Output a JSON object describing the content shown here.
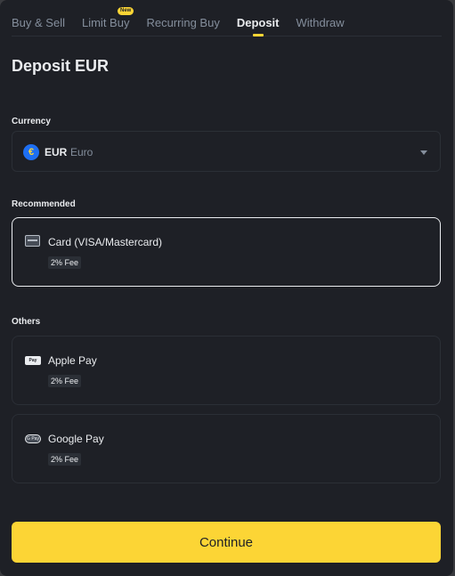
{
  "tabs": [
    {
      "label": "Buy & Sell"
    },
    {
      "label": "Limit Buy",
      "badge": "New"
    },
    {
      "label": "Recurring Buy"
    },
    {
      "label": "Deposit"
    },
    {
      "label": "Withdraw"
    }
  ],
  "active_tab": "Deposit",
  "title": "Deposit EUR",
  "currency": {
    "label": "Currency",
    "symbol": "€",
    "code": "EUR",
    "name": "Euro"
  },
  "recommended": {
    "label": "Recommended",
    "methods": [
      {
        "name": "Card (VISA/Mastercard)",
        "fee": "2% Fee",
        "icon": "card-icon"
      }
    ]
  },
  "others": {
    "label": "Others",
    "methods": [
      {
        "name": "Apple Pay",
        "fee": "2% Fee",
        "icon": "apple-pay-icon",
        "icon_text": "Pay"
      },
      {
        "name": "Google Pay",
        "fee": "2% Fee",
        "icon": "google-pay-icon",
        "icon_text": "G Pay"
      }
    ]
  },
  "continue_label": "Continue",
  "colors": {
    "background": "#1e2026",
    "accent": "#fcd535",
    "text": "#eaecef",
    "muted": "#848e9c",
    "border": "#2b2f36"
  }
}
